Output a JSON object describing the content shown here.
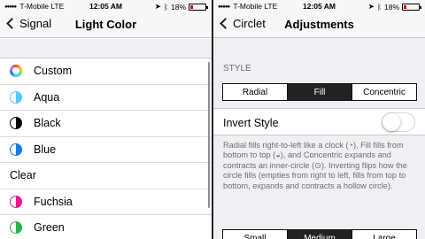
{
  "left": {
    "status": {
      "carrier": "T-Mobile",
      "network": "LTE",
      "time": "12:05 AM",
      "battery": "18%",
      "battery_fraction": 0.18
    },
    "nav": {
      "back_label": "Signal",
      "title": "Light Color"
    },
    "items": [
      {
        "label": "Custom",
        "icon": "rainbow-ring-icon"
      },
      {
        "label": "Aqua",
        "icon": "aqua-fill-icon",
        "color": "#5ac8fa"
      },
      {
        "label": "Black",
        "icon": "black-fill-icon",
        "color": "#000000"
      },
      {
        "label": "Blue",
        "icon": "blue-fill-icon",
        "color": "#1a7ad9"
      },
      {
        "label": "Clear",
        "icon": ""
      },
      {
        "label": "Fuchsia",
        "icon": "fuchsia-fill-icon",
        "color": "#e8188b"
      },
      {
        "label": "Green",
        "icon": "green-fill-icon",
        "color": "#2bb34a"
      }
    ]
  },
  "right": {
    "status": {
      "carrier": "T-Mobile",
      "network": "LTE",
      "time": "12:05 AM",
      "battery": "18%",
      "battery_fraction": 0.18
    },
    "nav": {
      "back_label": "Circlet",
      "title": "Adjustments"
    },
    "section_header": "STYLE",
    "style_options": [
      "Radial",
      "Fill",
      "Concentric"
    ],
    "style_selected": "Fill",
    "invert_label": "Invert Style",
    "invert_on": false,
    "footer": "Radial fills right-to-left like a clock (◔), Fill fills from bottom to top (◒), and Concentric expands and contracts an inner-circle (⊙). Inverting flips how the circle fills (empties from right to left, fills from top to bottom, expands and contracts a hollow circle).",
    "size_options": [
      "Small",
      "Medium",
      "Large"
    ],
    "size_selected": "Medium"
  }
}
